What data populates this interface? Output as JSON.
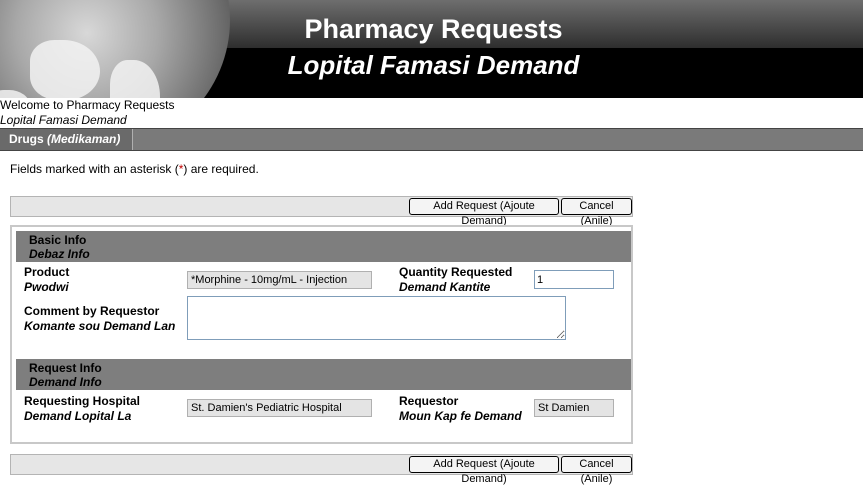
{
  "banner": {
    "title": "Pharmacy Requests",
    "subtitle": "Lopital Famasi Demand"
  },
  "welcome": {
    "line1": "Welcome to Pharmacy Requests",
    "line2": "Lopital Famasi Demand"
  },
  "tabs": [
    {
      "label": "Drugs",
      "label_kreyol": "(Medikaman)"
    }
  ],
  "required_note": {
    "before": "Fields marked with an asterisk (",
    "asterisk": "*",
    "after": ") are required."
  },
  "buttons": {
    "add_request": "Add Request (Ajoute Demand)",
    "cancel": "Cancel (Anile)"
  },
  "sections": {
    "basic": {
      "title": "Basic Info",
      "title_kreyol": "Debaz Info"
    },
    "request": {
      "title": "Request Info",
      "title_kreyol": "Demand Info"
    }
  },
  "fields": {
    "product": {
      "label": "Product",
      "label_kreyol": "Pwodwi",
      "value": "*Morphine - 10mg/mL - Injection"
    },
    "quantity": {
      "label": "Quantity Requested",
      "label_kreyol": "Demand Kantite",
      "value": "1"
    },
    "comment": {
      "label": "Comment by Requestor",
      "label_kreyol": "Komante sou Demand Lan",
      "value": ""
    },
    "hospital": {
      "label": "Requesting Hospital",
      "label_kreyol": "Demand Lopital La",
      "value": "St. Damien's Pediatric Hospital"
    },
    "requestor": {
      "label": "Requestor",
      "label_kreyol": "Moun Kap fe Demand",
      "value": "St  Damien"
    }
  },
  "colors": {
    "section_header": "#7e7e7e",
    "tab_bar": "#7a7a7a",
    "asterisk": "#c00000"
  }
}
